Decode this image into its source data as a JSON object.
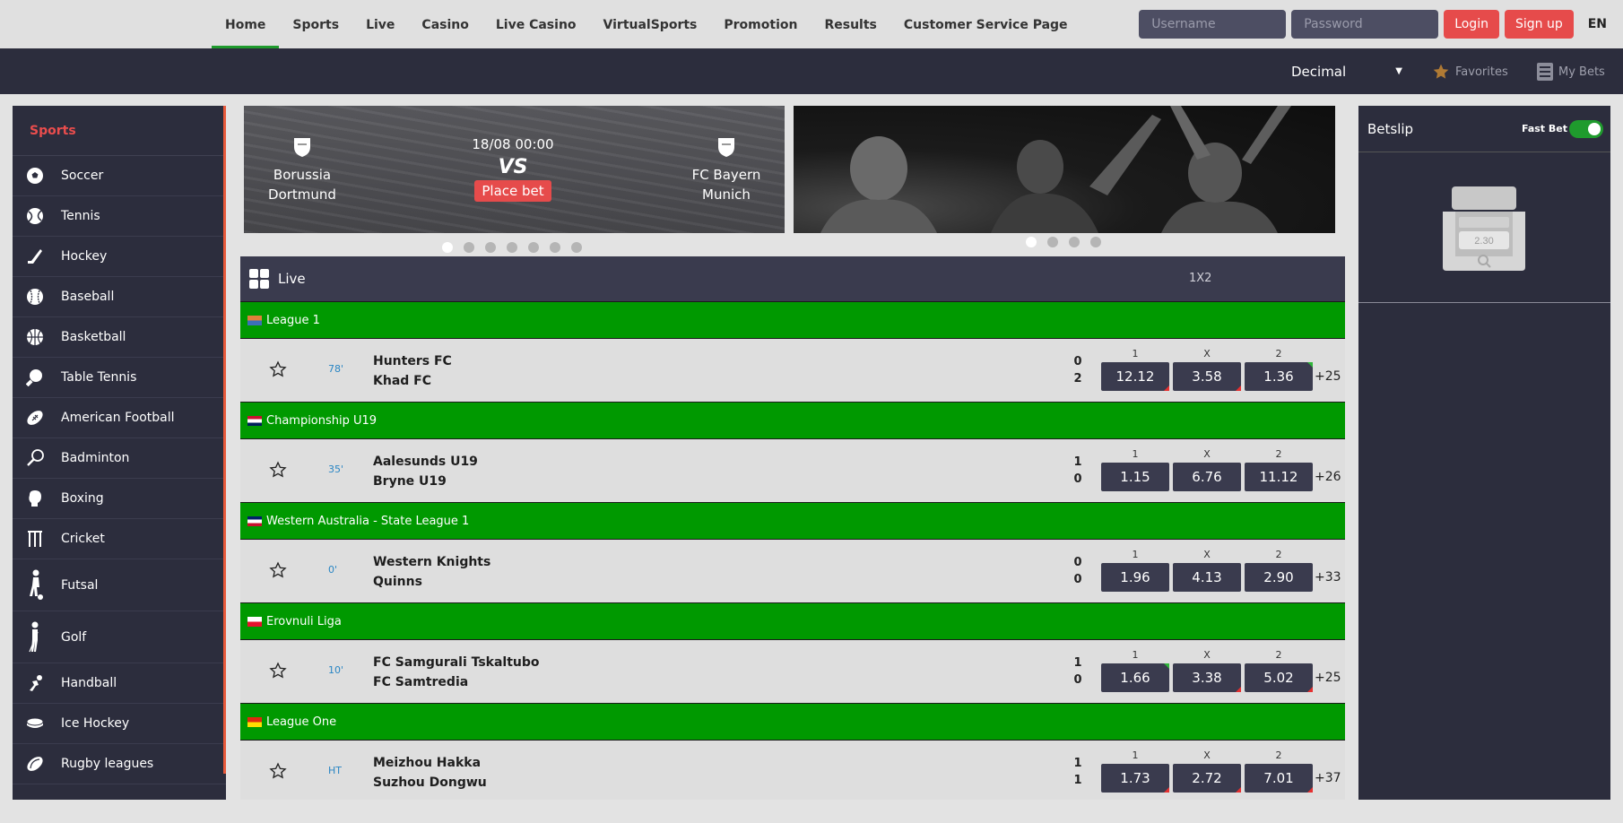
{
  "nav": {
    "items": [
      {
        "label": "Home",
        "active": true
      },
      {
        "label": "Sports"
      },
      {
        "label": "Live"
      },
      {
        "label": "Casino"
      },
      {
        "label": "Live Casino"
      },
      {
        "label": "VirtualSports"
      },
      {
        "label": "Promotion"
      },
      {
        "label": "Results"
      },
      {
        "label": "Customer Service Page"
      }
    ],
    "username_placeholder": "Username",
    "password_placeholder": "Password",
    "login_label": "Login",
    "signup_label": "Sign up",
    "language": "EN"
  },
  "subbar": {
    "odds_format": "Decimal",
    "favorites_label": "Favorites",
    "mybets_label": "My Bets"
  },
  "sidebar": {
    "title": "Sports",
    "items": [
      {
        "label": "Soccer",
        "icon": "soccer-ball-icon"
      },
      {
        "label": "Tennis",
        "icon": "tennis-ball-icon"
      },
      {
        "label": "Hockey",
        "icon": "hockey-stick-icon"
      },
      {
        "label": "Baseball",
        "icon": "baseball-icon"
      },
      {
        "label": "Basketball",
        "icon": "basketball-icon"
      },
      {
        "label": "Table Tennis",
        "icon": "table-tennis-icon"
      },
      {
        "label": "American Football",
        "icon": "american-football-icon"
      },
      {
        "label": "Badminton",
        "icon": "badminton-icon"
      },
      {
        "label": "Boxing",
        "icon": "boxing-glove-icon"
      },
      {
        "label": "Cricket",
        "icon": "cricket-icon"
      },
      {
        "label": "Futsal",
        "icon": "futsal-player-icon"
      },
      {
        "label": "Golf",
        "icon": "golfer-icon"
      },
      {
        "label": "Handball",
        "icon": "handball-icon"
      },
      {
        "label": "Ice Hockey",
        "icon": "ice-hockey-puck-icon"
      },
      {
        "label": "Rugby leagues",
        "icon": "rugby-ball-icon"
      }
    ]
  },
  "banner": {
    "home_team": "Borussia Dortmund",
    "away_team": "FC Bayern Munich",
    "datetime": "18/08 00:00",
    "vs": "VS",
    "place_bet": "Place bet"
  },
  "live": {
    "title": "Live",
    "market_header": "1X2",
    "outcome_labels": [
      "1",
      "X",
      "2"
    ],
    "events": [
      {
        "league": "League 1",
        "flag_colors": [
          "#e0803a",
          "#3d6fb8"
        ],
        "time": "78'",
        "home": "Hunters FC",
        "away": "Khad FC",
        "home_score": "0",
        "away_score": "2",
        "odds": [
          {
            "value": "12.12",
            "trend": "down"
          },
          {
            "value": "3.58",
            "trend": "down"
          },
          {
            "value": "1.36",
            "trend": "up"
          }
        ],
        "more": "+25"
      },
      {
        "league": "Championship U19",
        "flag_colors": [
          "#c8102e",
          "#ffffff",
          "#00205b"
        ],
        "time": "35'",
        "home": "Aalesunds U19",
        "away": "Bryne U19",
        "home_score": "1",
        "away_score": "0",
        "odds": [
          {
            "value": "1.15",
            "trend": ""
          },
          {
            "value": "6.76",
            "trend": ""
          },
          {
            "value": "11.12",
            "trend": ""
          }
        ],
        "more": "+26"
      },
      {
        "league": "Western Australia - State League 1",
        "flag_colors": [
          "#012169",
          "#ffffff",
          "#c8102e"
        ],
        "time": "0'",
        "home": "Western Knights",
        "away": "Quinns",
        "home_score": "0",
        "away_score": "0",
        "odds": [
          {
            "value": "1.96",
            "trend": ""
          },
          {
            "value": "4.13",
            "trend": ""
          },
          {
            "value": "2.90",
            "trend": ""
          }
        ],
        "more": "+33"
      },
      {
        "league": "Erovnuli Liga",
        "flag_colors": [
          "#ffffff",
          "#e8112d"
        ],
        "time": "10'",
        "home": "FC Samgurali Tskaltubo",
        "away": "FC Samtredia",
        "home_score": "1",
        "away_score": "0",
        "odds": [
          {
            "value": "1.66",
            "trend": "up"
          },
          {
            "value": "3.38",
            "trend": "down"
          },
          {
            "value": "5.02",
            "trend": "down"
          }
        ],
        "more": "+25"
      },
      {
        "league": "League One",
        "flag_colors": [
          "#de2910",
          "#ffde00"
        ],
        "time": "HT",
        "home": "Meizhou Hakka",
        "away": "Suzhou Dongwu",
        "home_score": "1",
        "away_score": "1",
        "odds": [
          {
            "value": "1.73",
            "trend": "down"
          },
          {
            "value": "2.72",
            "trend": "down"
          },
          {
            "value": "7.01",
            "trend": "down"
          }
        ],
        "more": "+37"
      }
    ]
  },
  "betslip": {
    "title": "Betslip",
    "fast_bet_label": "Fast Bet",
    "fast_bet_on": true,
    "empty_illustration_value": "2.30"
  },
  "colors": {
    "accent_red": "#e64b4b",
    "league_green": "#009900",
    "dark_panel": "#2c2d3d",
    "odds_button": "#3a3b4e"
  }
}
